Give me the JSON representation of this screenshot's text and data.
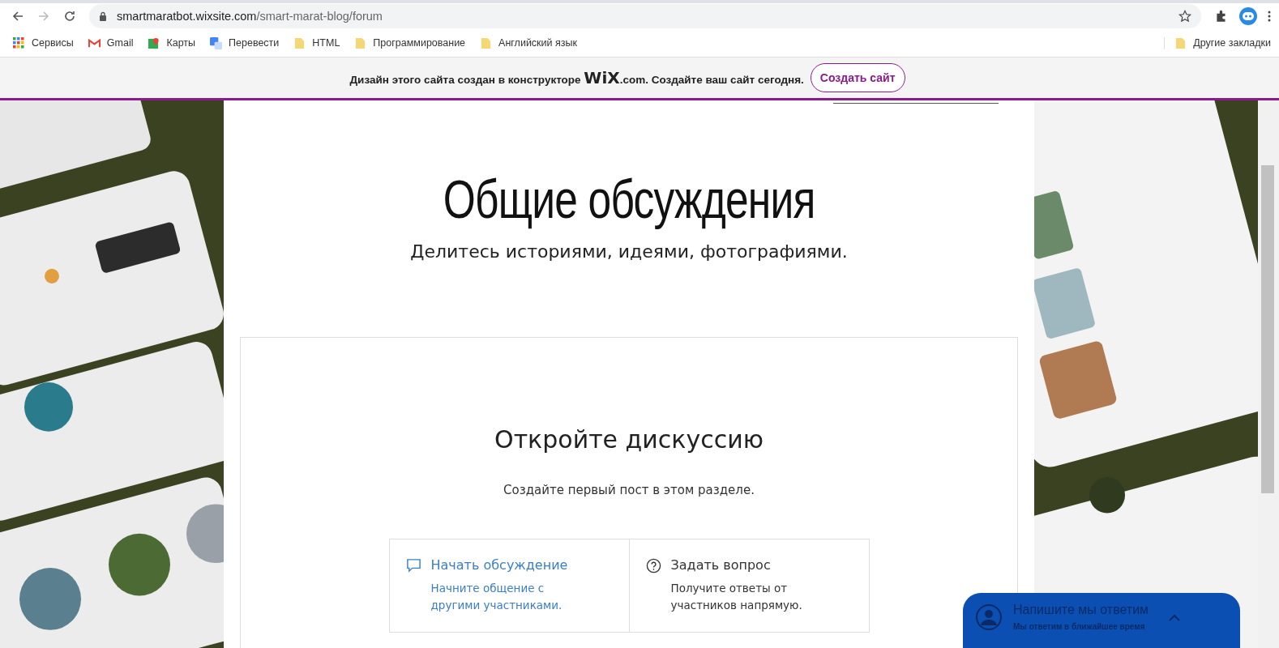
{
  "browser": {
    "url_host": "smartmaratbot.wixsite.com",
    "url_path": "/smart-marat-blog/forum",
    "bookmarks": [
      {
        "label": "Сервисы",
        "kind": "apps"
      },
      {
        "label": "Gmail",
        "kind": "gmail"
      },
      {
        "label": "Карты",
        "kind": "maps"
      },
      {
        "label": "Перевести",
        "kind": "translate"
      },
      {
        "label": "HTML",
        "kind": "folder"
      },
      {
        "label": "Программирование",
        "kind": "folder"
      },
      {
        "label": "Английский язык",
        "kind": "folder"
      }
    ],
    "other_bookmarks": "Другие закладки"
  },
  "wix_banner": {
    "text_before": "Дизайн этого сайта создан в конструкторе",
    "logo": "WiX",
    "logo_suffix": ".com.",
    "text_after": "Создайте ваш сайт сегодня.",
    "button": "Создать сайт"
  },
  "page": {
    "title": "Общие обсуждения",
    "subtitle": "Делитесь историями, идеями, фотографиями.",
    "empty_title": "Откройте дискуссию",
    "empty_text": "Создайте первый пост в этом разделе.",
    "options": [
      {
        "kind": "discussion",
        "title": "Начать обсуждение",
        "text": "Начните общение с другими участниками.",
        "hovered": true
      },
      {
        "kind": "question",
        "title": "Задать вопрос",
        "text": "Получите ответы от участников напрямую.",
        "hovered": false
      }
    ]
  },
  "chat": {
    "title": "Напишите мы ответим",
    "subtitle": "Мы ответим в ближайшее время"
  }
}
